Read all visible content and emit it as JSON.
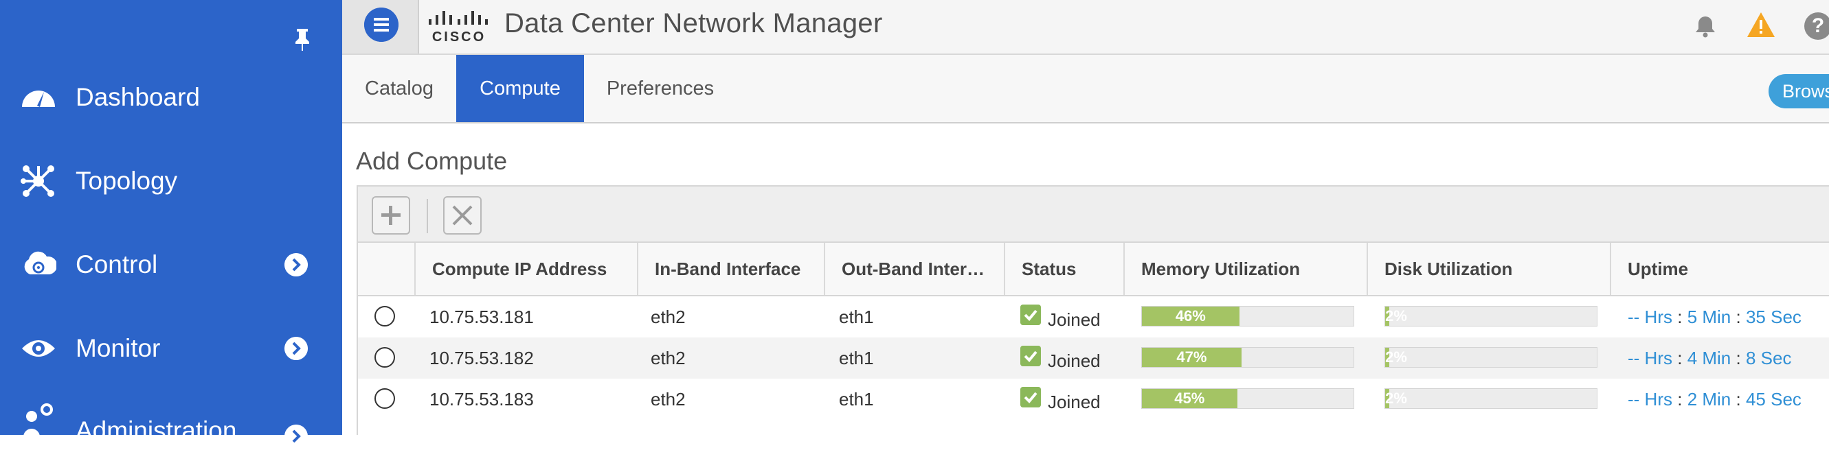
{
  "sidebar": {
    "items": [
      {
        "label": "Dashboard",
        "icon": "dashboard-icon",
        "has_chevron": false
      },
      {
        "label": "Topology",
        "icon": "topology-icon",
        "has_chevron": false
      },
      {
        "label": "Control",
        "icon": "control-icon",
        "has_chevron": true
      },
      {
        "label": "Monitor",
        "icon": "eye-icon",
        "has_chevron": true
      },
      {
        "label": "Administration",
        "icon": "admin-gear-icon",
        "has_chevron": true
      }
    ]
  },
  "header": {
    "logo_text": "CISCO",
    "title": "Data Center Network Manager"
  },
  "tabs": [
    {
      "label": "Catalog",
      "active": false
    },
    {
      "label": "Compute",
      "active": true
    },
    {
      "label": "Preferences",
      "active": false
    }
  ],
  "browse_label": "Browse",
  "section_title": "Add Compute",
  "toolbar": {
    "add_symbol": "+",
    "delete_symbol": "×"
  },
  "table": {
    "columns": [
      "Compute IP Address",
      "In-Band Interface",
      "Out-Band Inter…",
      "Status",
      "Memory Utilization",
      "Disk Utilization",
      "Uptime"
    ],
    "rows": [
      {
        "ip": "10.75.53.181",
        "inband": "eth2",
        "outband": "eth1",
        "status": "Joined",
        "memory_pct": 46,
        "memory_label": "46%",
        "disk_pct": 2,
        "disk_label": "2%",
        "hrs": "-- Hrs",
        "min": "5 Min",
        "sec": "35 Sec"
      },
      {
        "ip": "10.75.53.182",
        "inband": "eth2",
        "outband": "eth1",
        "status": "Joined",
        "memory_pct": 47,
        "memory_label": "47%",
        "disk_pct": 2,
        "disk_label": "2%",
        "hrs": "-- Hrs",
        "min": "4 Min",
        "sec": "8 Sec"
      },
      {
        "ip": "10.75.53.183",
        "inband": "eth2",
        "outband": "eth1",
        "status": "Joined",
        "memory_pct": 45,
        "memory_label": "45%",
        "disk_pct": 2,
        "disk_label": "2%",
        "hrs": "-- Hrs",
        "min": "2 Min",
        "sec": "45 Sec"
      }
    ],
    "uptime_separator": ":"
  },
  "colors": {
    "primary": "#2c64c9",
    "accent": "#3ea0da",
    "bar_fill": "#a4c464",
    "check": "#8bb85a",
    "link": "#2f8fd5",
    "warning": "#f5a623"
  }
}
